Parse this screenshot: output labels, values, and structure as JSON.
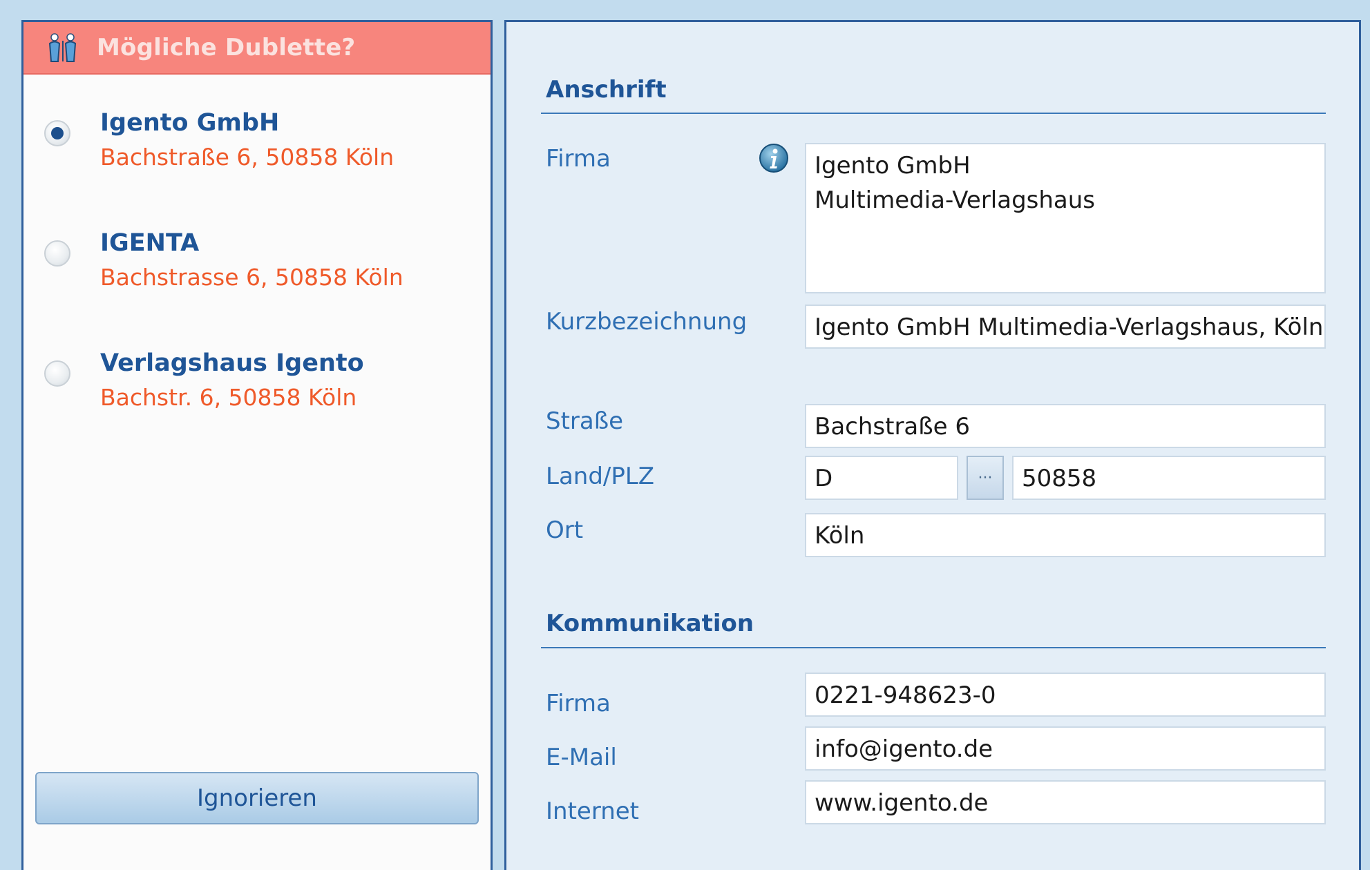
{
  "duplicates": {
    "title": "Mögliche Dublette?",
    "icon": "duplicate-persons-icon",
    "candidates": [
      {
        "name": "Igento GmbH",
        "address": "Bachstraße 6, 50858 Köln",
        "selected": true
      },
      {
        "name": "IGENTA",
        "address": "Bachstrasse 6, 50858 Köln",
        "selected": false
      },
      {
        "name": "Verlagshaus Igento",
        "address": "Bachstr. 6, 50858 Köln",
        "selected": false
      }
    ],
    "ignore_label": "Ignorieren"
  },
  "anschrift": {
    "title": "Anschrift",
    "firma_label": "Firma",
    "firma_line1": "Igento GmbH",
    "firma_line2": "Multimedia-Verlagshaus",
    "kurz_label": "Kurzbezeichnung",
    "kurz_value": "Igento GmbH Multimedia-Verlagshaus, Köln",
    "strasse_label": "Straße",
    "strasse_value": "Bachstraße 6",
    "landplz_label": "Land/PLZ",
    "land_value": "D",
    "dots_label": "···",
    "plz_value": "50858",
    "ort_label": "Ort",
    "ort_value": "Köln"
  },
  "kommunikation": {
    "title": "Kommunikation",
    "firma_label": "Firma",
    "firma_value": "0221-948623-0",
    "email_label": "E-Mail",
    "email_value": "info@igento.de",
    "internet_label": "Internet",
    "internet_value": "www.igento.de"
  },
  "colors": {
    "accent_blue": "#1f5597",
    "duplicate_header": "#f7857d",
    "address_orange": "#ef5a2a",
    "panel_bg": "#e4eef7"
  }
}
